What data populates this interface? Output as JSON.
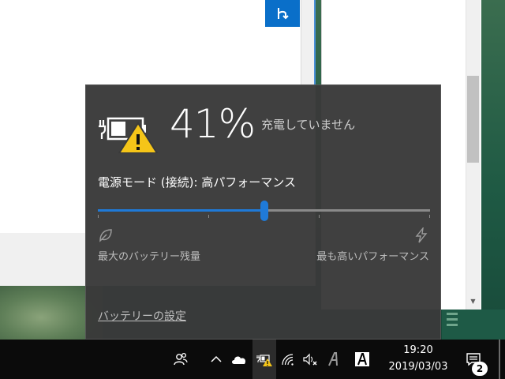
{
  "battery": {
    "percent_text": "41%",
    "percent_value": 41,
    "status": "充電していません"
  },
  "power_mode": {
    "label": "電源モード (接続): 高パフォーマンス",
    "slider_fraction": 0.5,
    "left_label": "最大のバッテリー残量",
    "right_label": "最も高いパフォーマンス"
  },
  "settings_link": "バッテリーの設定",
  "taskbar": {
    "time": "19:20",
    "date": "2019/03/03",
    "notification_count": "2"
  },
  "colors": {
    "accent": "#1f7ad8",
    "warning": "#f5c518",
    "flyout_bg": "#3a3a3a"
  },
  "icons": [
    "people-icon",
    "chevron-up-icon",
    "onedrive-icon",
    "battery-warning-icon",
    "wifi-icon",
    "volume-muted-icon",
    "font-a-icon",
    "notification-center-icon",
    "leaf-icon",
    "bolt-icon"
  ]
}
